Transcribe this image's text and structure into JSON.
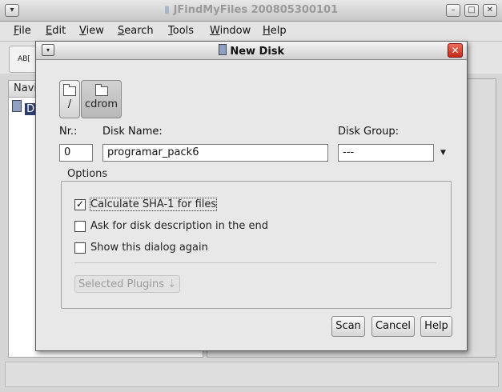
{
  "main_window": {
    "title": "JFindMyFiles 200805300101",
    "menu": [
      {
        "label": "File",
        "mnemonic": "F",
        "rest": "ile"
      },
      {
        "label": "Edit",
        "mnemonic": "E",
        "rest": "dit"
      },
      {
        "label": "View",
        "mnemonic": "V",
        "rest": "iew"
      },
      {
        "label": "Search",
        "mnemonic": "S",
        "rest": "earch"
      },
      {
        "label": "Tools",
        "mnemonic": "T",
        "rest": "ools"
      },
      {
        "label": "Window",
        "mnemonic": "W",
        "rest": "indow"
      },
      {
        "label": "Help",
        "mnemonic": "H",
        "rest": "elp"
      }
    ],
    "toolbar_button_text": "AB[",
    "left_panel_header": "Navi",
    "tree_node_text": "D"
  },
  "dialog": {
    "title": "New Disk",
    "devices": [
      {
        "label": "/",
        "selected": false
      },
      {
        "label": "cdrom",
        "selected": true
      }
    ],
    "nr": {
      "label": "Nr.:",
      "value": "0"
    },
    "disk_name": {
      "label": "Disk Name:",
      "value": "programar_pack6"
    },
    "disk_group": {
      "label": "Disk Group:",
      "value": "---"
    },
    "options": {
      "legend": "Options",
      "checkboxes": [
        {
          "label": "Calculate SHA-1 for files",
          "checked": true
        },
        {
          "label": "Ask for disk description in the end",
          "checked": false
        },
        {
          "label": "Show this dialog again",
          "checked": false
        }
      ],
      "plugins_button": "Selected Plugins"
    },
    "buttons": {
      "scan": "Scan",
      "cancel": "Cancel",
      "help": "Help"
    }
  }
}
